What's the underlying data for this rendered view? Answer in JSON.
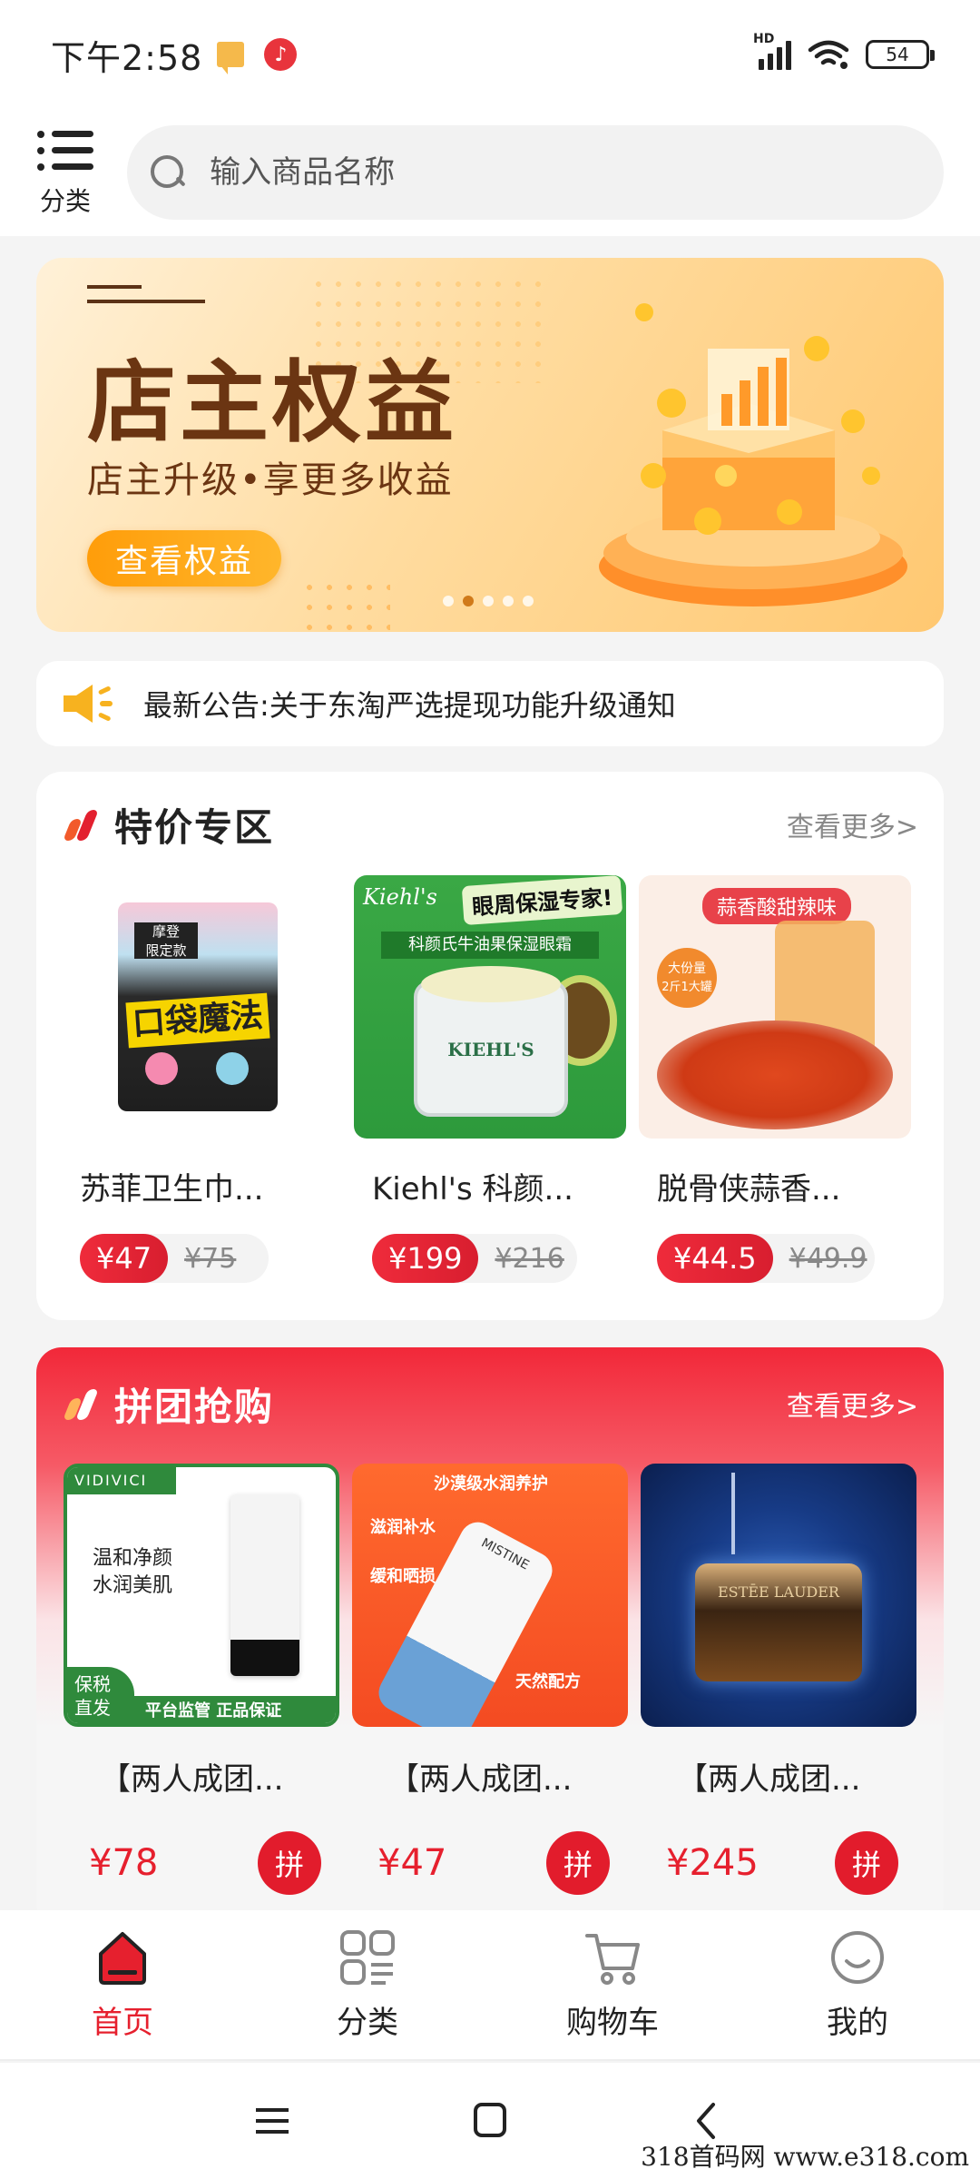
{
  "status_bar": {
    "time": "下午2:58",
    "network": "HD",
    "battery": "54"
  },
  "header": {
    "category_label": "分类",
    "search_placeholder": "输入商品名称"
  },
  "banner": {
    "title": "店主权益",
    "subtitle": "店主升级•享更多收益",
    "button_label": "查看权益",
    "page_count": 5,
    "active_page": 2
  },
  "notice": {
    "text": "最新公告:关于东淘严选提现功能升级通知"
  },
  "sale_section": {
    "title": "特价专区",
    "more_label": "查看更多>",
    "products": [
      {
        "name": "苏菲卫生巾...",
        "price": "¥47",
        "old_price": "¥75",
        "image_text": [
          "摩登",
          "限定款",
          "口袋魔法"
        ]
      },
      {
        "name": "Kiehl's 科颜...",
        "price": "¥199",
        "old_price": "¥216",
        "image_text": [
          "Kiehl's",
          "眼周保湿专家!",
          "科颜氏牛油果保湿眼霜",
          "KIEHL'S"
        ]
      },
      {
        "name": "脱骨侠蒜香...",
        "price": "¥44.5",
        "old_price": "¥49.9",
        "image_text": [
          "蒜香酸甜辣味",
          "大份量",
          "2斤1大罐"
        ]
      }
    ]
  },
  "group_section": {
    "title": "拼团抢购",
    "more_label": "查看更多>",
    "pin_label": "拼",
    "products": [
      {
        "name": "【两人成团...",
        "price": "¥78",
        "image_text": [
          "VIDIVICI",
          "温和净颜",
          "水润美肌",
          "保税",
          "直发",
          "平台监管 正品保证"
        ]
      },
      {
        "name": "【两人成团...",
        "price": "¥47",
        "image_text": [
          "沙漠级水润养护",
          "滋润补水",
          "缓和晒损",
          "天然配方",
          "MISTINE"
        ]
      },
      {
        "name": "【两人成团...",
        "price": "¥245",
        "image_text": [
          "ESTĒE LAUDER"
        ]
      }
    ]
  },
  "bottom_nav": {
    "items": [
      {
        "label": "首页",
        "icon": "home-icon",
        "active": true
      },
      {
        "label": "分类",
        "icon": "category-grid-icon",
        "active": false
      },
      {
        "label": "购物车",
        "icon": "cart-icon",
        "active": false
      },
      {
        "label": "我的",
        "icon": "profile-icon",
        "active": false
      }
    ]
  },
  "watermark": "318首码网 www.e318.com",
  "colors": {
    "accent_red": "#e6202e",
    "banner_orange": "#ffb62b",
    "banner_text": "#6b3512"
  }
}
